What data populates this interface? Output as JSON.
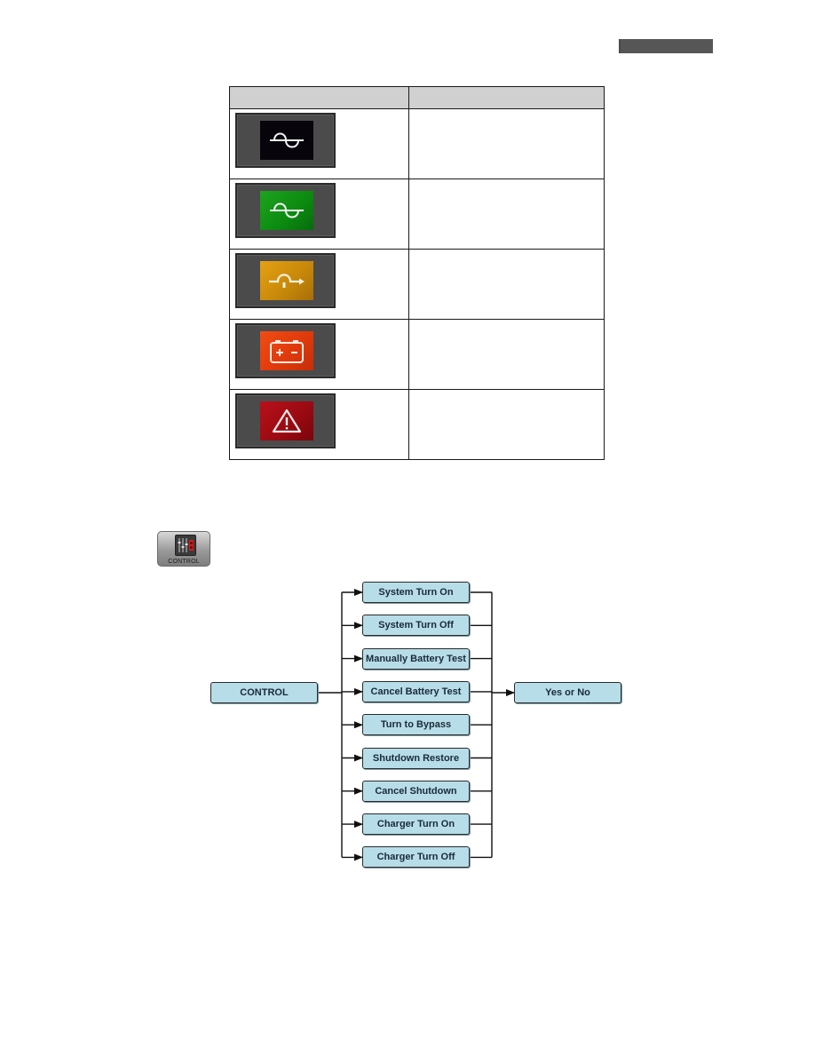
{
  "header": {
    "bar_color": "#565656"
  },
  "status_table": {
    "columns": [
      "",
      ""
    ],
    "rows": [
      {
        "icon": "ac-sine-wave-icon",
        "icon_color": "#07040c",
        "description": ""
      },
      {
        "icon": "ac-sine-wave-icon",
        "icon_color": "#12991a",
        "description": ""
      },
      {
        "icon": "bypass-arrow-icon",
        "icon_color": "#d4920e",
        "description": ""
      },
      {
        "icon": "battery-icon",
        "icon_color": "#e8420f",
        "description": ""
      },
      {
        "icon": "warning-triangle-icon",
        "icon_color": "#a80d16",
        "description": ""
      }
    ]
  },
  "control_icon": {
    "label": "CONTROL"
  },
  "flow": {
    "root": "CONTROL",
    "options": [
      "System Turn On",
      "System Turn Off",
      "Manually Battery Test",
      "Cancel Battery Test",
      "Turn to Bypass",
      "Shutdown Restore",
      "Cancel Shutdown",
      "Charger Turn On",
      "Charger Turn Off"
    ],
    "confirm": "Yes or No",
    "box_color": "#b7dde8"
  }
}
